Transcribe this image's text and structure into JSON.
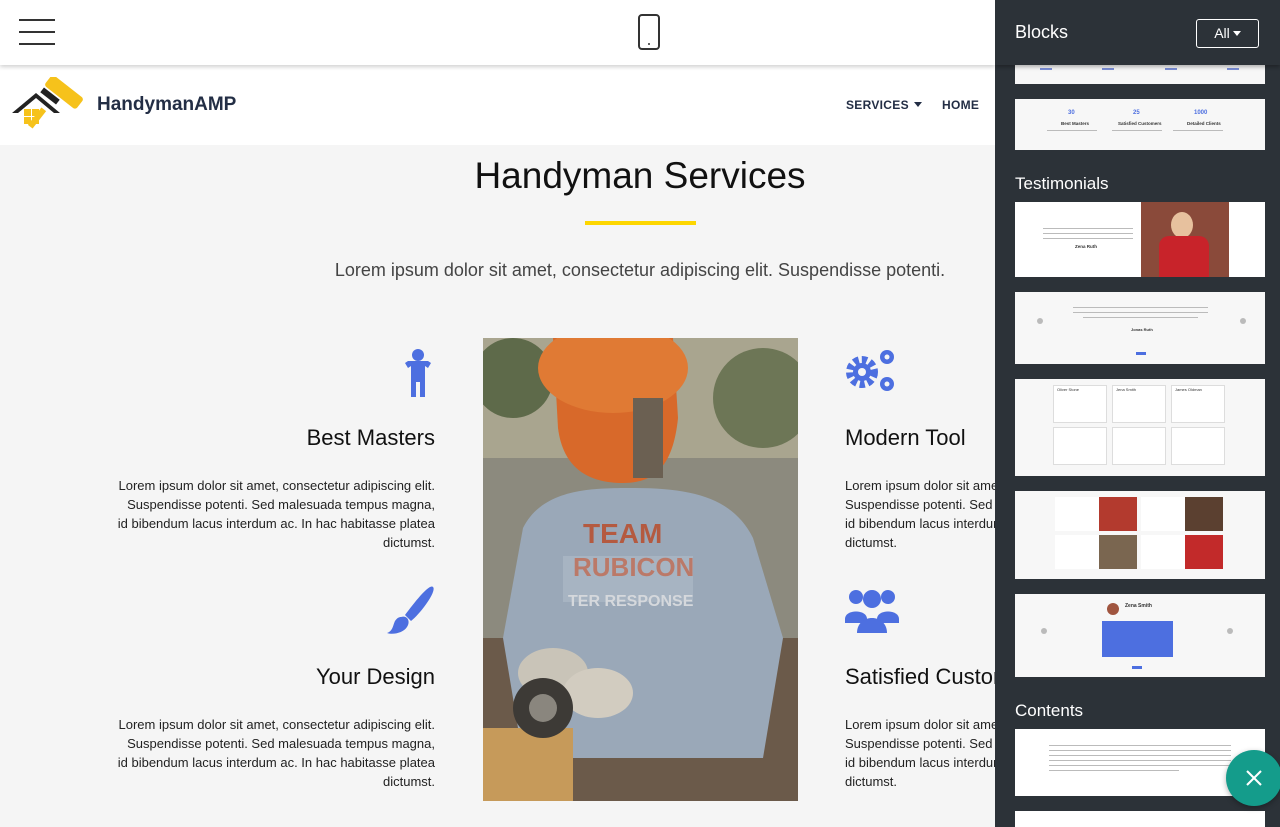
{
  "site": {
    "brand": "HandymanAMP",
    "nav": [
      {
        "label": "SERVICES",
        "has_caret": true
      },
      {
        "label": "HOME",
        "has_caret": false
      }
    ]
  },
  "main": {
    "title": "Handyman Services",
    "subtitle": "Lorem ipsum dolor sit amet, consectetur adipiscing elit. Suspendisse potenti.",
    "features": [
      {
        "title": "Best Masters",
        "icon": "person-icon",
        "text": "Lorem ipsum dolor sit amet, consectetur adipiscing elit. Suspendisse potenti. Sed malesuada tempus magna, id bibendum lacus interdum ac. In hac habitasse platea dictumst."
      },
      {
        "title": "Modern Tool",
        "icon": "gears-icon",
        "text": "Lorem ipsum dolor sit amet, consectetur adipiscing elit. Suspendisse potenti. Sed malesuada tempus magna, id bibendum lacus interdum ac. In hac habitasse platea dictumst."
      },
      {
        "title": "Your Design",
        "icon": "brush-icon",
        "text": "Lorem ipsum dolor sit amet, consectetur adipiscing elit. Suspendisse potenti. Sed malesuada tempus magna, id bibendum lacus interdum ac. In hac habitasse platea dictumst."
      },
      {
        "title": "Satisfied Customers",
        "icon": "users-icon",
        "text": "Lorem ipsum dolor sit amet, consectetur adipiscing elit. Suspendisse potenti. Sed malesuada tempus magna, id bibendum lacus interdum ac. In hac habitasse platea dictumst."
      }
    ],
    "photo_shirt": {
      "line1": "TEAM",
      "line2": "RUBICON",
      "line3": "TER RESPONSE"
    }
  },
  "sidebar": {
    "title": "Blocks",
    "filter": "All",
    "sections": [
      "Testimonials",
      "Contents"
    ],
    "counters": [
      {
        "value": "30",
        "label": "Best Masters"
      },
      {
        "value": "25",
        "label": "Satisfied Customers"
      },
      {
        "value": "1000",
        "label": "Detailed Clients"
      }
    ],
    "testimonial_names": [
      "Zena Ruth",
      "Jonas Ruth",
      "Oliver Stone",
      "Jena Smith",
      "James Oldman",
      "Zena Smith"
    ]
  },
  "colors": {
    "accent_yellow": "#fdd600",
    "icon_blue": "#4d6fe0",
    "sidebar_bg": "#2c3238",
    "fab": "#149c8b"
  }
}
